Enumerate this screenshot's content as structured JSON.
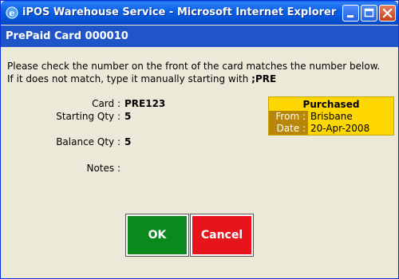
{
  "window": {
    "title": "iPOS Warehouse Service - Microsoft Internet Explorer"
  },
  "header": {
    "title": "PrePaid Card 000010"
  },
  "instructions": {
    "line1": "Please check the number on the front of the card matches the number below.",
    "line2_prefix": "If it does not match, type it manually starting with ",
    "line2_code": ";PRE"
  },
  "fields": {
    "card_label": "Card :",
    "card_value": "PRE123",
    "starting_qty_label": "Starting Qty :",
    "starting_qty_value": "5",
    "balance_qty_label": "Balance Qty :",
    "balance_qty_value": "5",
    "notes_label": "Notes :",
    "notes_value": ""
  },
  "purchased": {
    "title": "Purchased",
    "from_label": "From :",
    "from_value": "Brisbane",
    "date_label": "Date :",
    "date_value": "20-Apr-2008"
  },
  "buttons": {
    "ok_label": "OK",
    "cancel_label": "Cancel"
  },
  "colors": {
    "title_bar": "#0A5EE8",
    "header_bar": "#1F55C9",
    "purchased_bg": "#FFD700",
    "purchased_label_bg": "#B8860B",
    "ok_bg": "#0A8A1C",
    "cancel_bg": "#E8141C"
  },
  "icons": {
    "app": "ie-icon",
    "minimize": "minimize-icon",
    "maximize": "maximize-icon",
    "close": "close-icon"
  }
}
